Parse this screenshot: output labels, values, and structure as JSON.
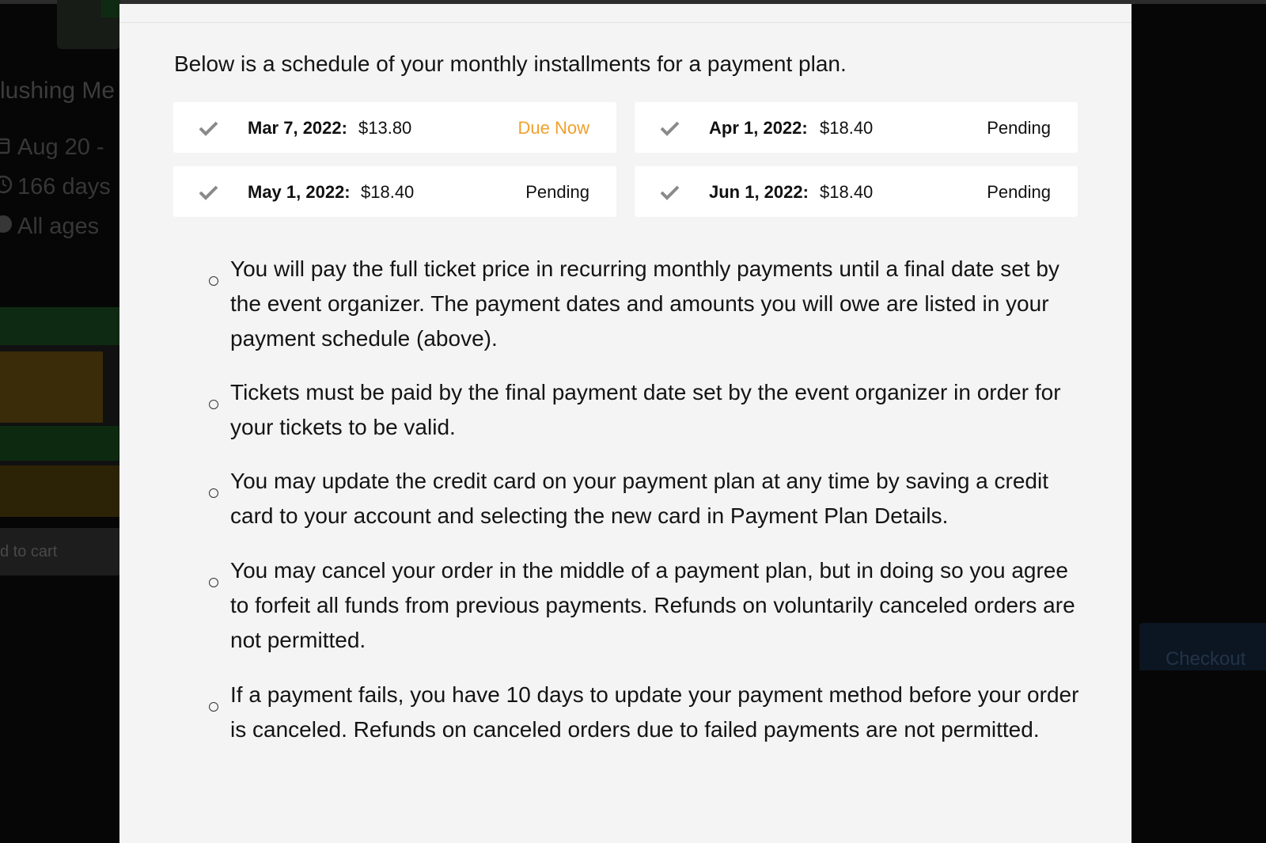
{
  "background": {
    "event_title": "lushing Me",
    "meta": [
      {
        "icon": "calendar-icon",
        "text": "Aug 20 -"
      },
      {
        "icon": "clock-icon",
        "text": "166 days"
      },
      {
        "icon": "age-icon",
        "text": "All ages"
      }
    ],
    "add_to_cart_label": "d to cart",
    "checkout_label": "Checkout"
  },
  "modal": {
    "intro": "Below is a schedule of your monthly installments for a payment plan.",
    "installments": [
      {
        "date": "Mar 7, 2022:",
        "amount": "$13.80",
        "status": "Due Now"
      },
      {
        "date": "Apr 1, 2022:",
        "amount": "$18.40",
        "status": "Pending"
      },
      {
        "date": "May 1, 2022:",
        "amount": "$18.40",
        "status": "Pending"
      },
      {
        "date": "Jun 1, 2022:",
        "amount": "$18.40",
        "status": "Pending"
      }
    ],
    "terms": [
      "You will pay the full ticket price in recurring monthly payments until a final date set by the event organizer. The payment dates and amounts you will owe are listed in your payment schedule (above).",
      "Tickets must be paid by the final payment date set by the event organizer in order for your tickets to be valid.",
      "You may update the credit card on your payment plan at any time by saving a credit card to your account and selecting the new card in Payment Plan Details.",
      "You may cancel your order in the middle of a payment plan, but in doing so you agree to forfeit all funds from previous payments. Refunds on voluntarily canceled orders are not permitted.",
      "If a payment fails, you have 10 days to update your payment method before your order is canceled. Refunds on canceled orders due to failed payments are not permitted."
    ]
  },
  "colors": {
    "due_now": "#f0a02c",
    "check": "#8a8a8a",
    "modal_bg": "#f4f4f4",
    "overlay_bg": "#060606"
  }
}
